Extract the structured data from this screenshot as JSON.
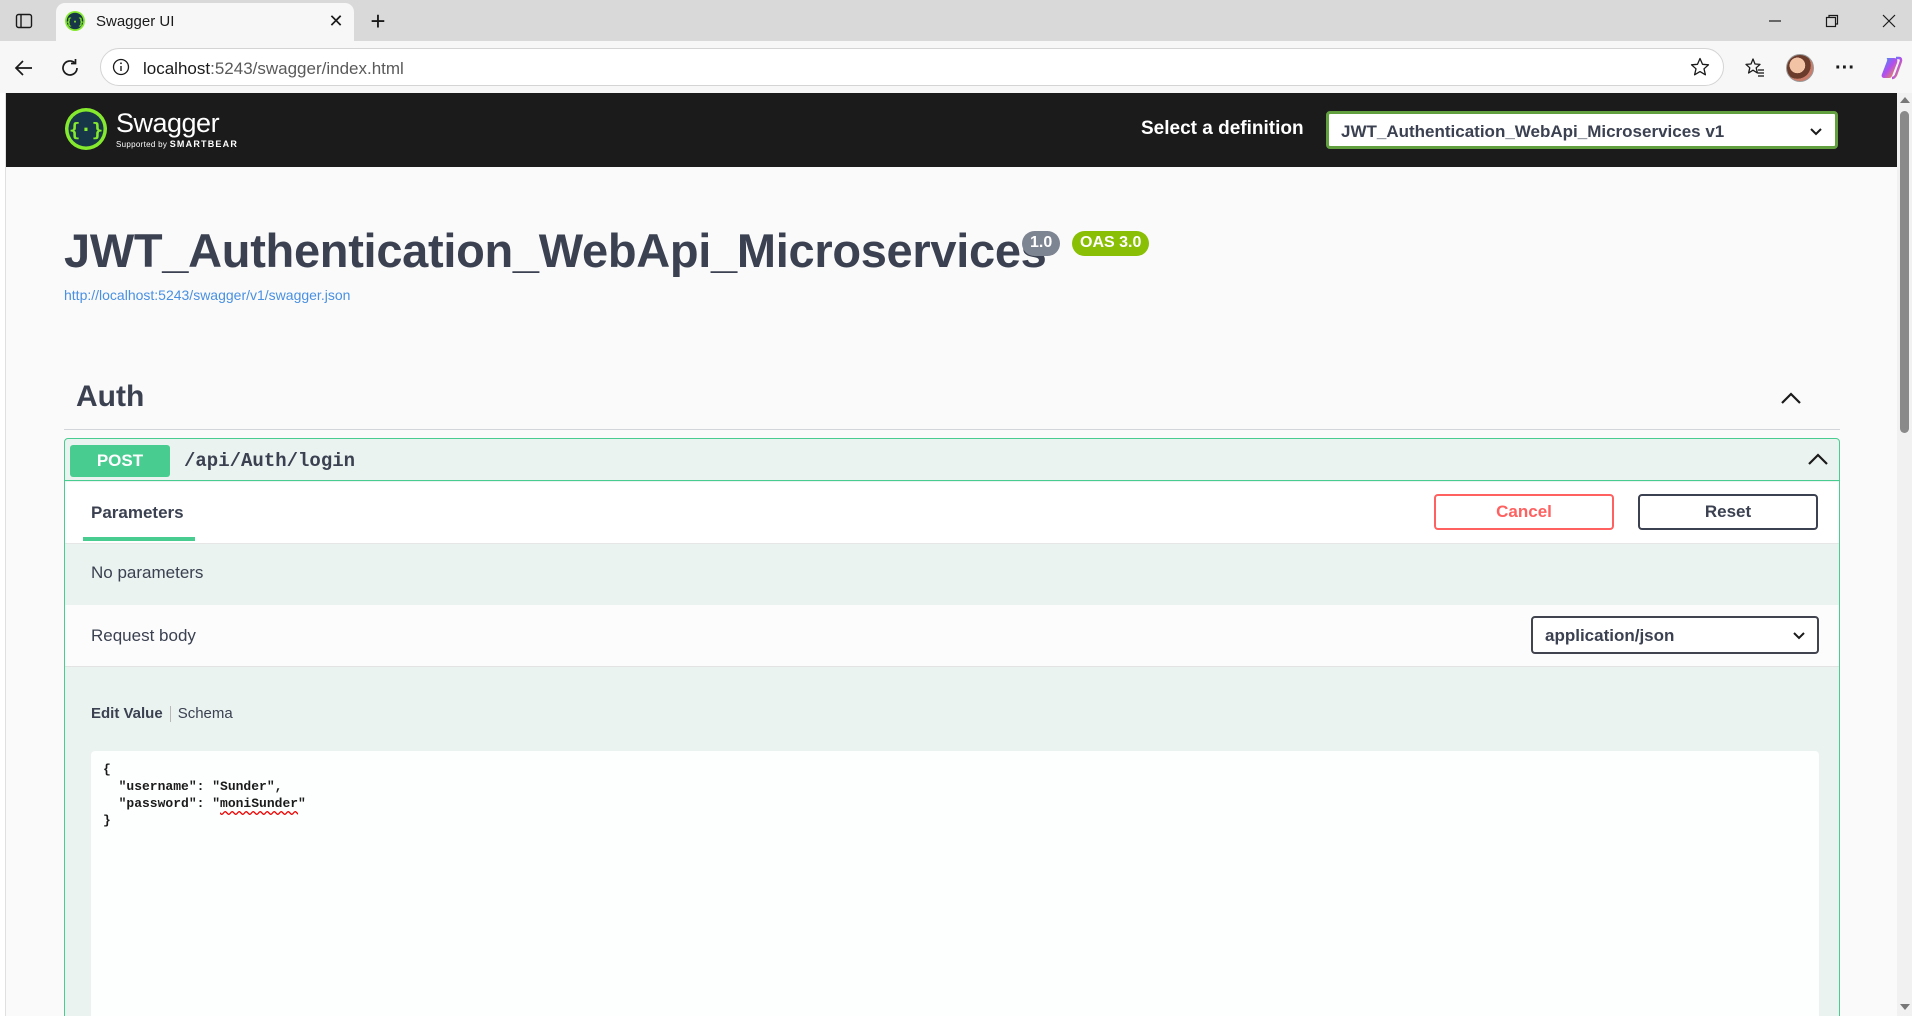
{
  "browser": {
    "tab_title": "Swagger UI",
    "url_host": "localhost",
    "url_rest": ":5243/swagger/index.html"
  },
  "topbar": {
    "logo_name": "Swagger",
    "logo_sub_prefix": "Supported by",
    "logo_sub_brand": "SMARTBEAR",
    "select_label": "Select a definition",
    "selected_definition": "JWT_Authentication_WebApi_Microservices v1"
  },
  "info": {
    "title": "JWT_Authentication_WebApi_Microservices",
    "version_badge": "1.0",
    "oas_badge": "OAS 3.0",
    "spec_url": "http://localhost:5243/swagger/v1/swagger.json"
  },
  "tag": {
    "name": "Auth"
  },
  "operation": {
    "method": "POST",
    "path": "/api/Auth/login",
    "params_tab": "Parameters",
    "cancel_label": "Cancel",
    "reset_label": "Reset",
    "no_params_text": "No parameters",
    "request_body_label": "Request body",
    "content_type": "application/json",
    "edit_value_tab": "Edit Value",
    "schema_tab": "Schema",
    "body": {
      "open": "{",
      "username_line": "  \"username\": \"Sunder\",",
      "password_key": "  \"password\": \"",
      "password_value": "moniSunder",
      "password_end": "\"",
      "close": "}"
    }
  },
  "colors": {
    "post_green": "#49cc90",
    "cancel_red": "#ff6060",
    "oas_badge": "#89bf04",
    "version_badge": "#7d8492",
    "topbar_bg": "#1b1b1b"
  }
}
